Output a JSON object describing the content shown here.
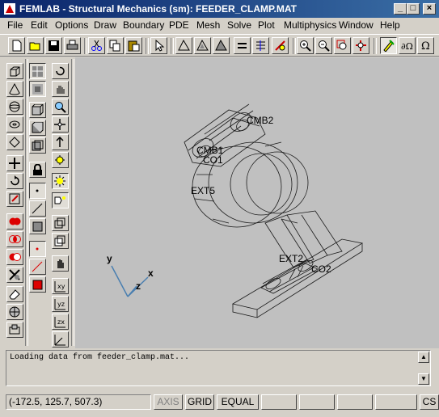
{
  "window": {
    "title": "FEMLAB - Structural Mechanics (sm): FEEDER_CLAMP.MAT"
  },
  "window_controls": {
    "minimize": "_",
    "maximize": "□",
    "close": "×"
  },
  "menu": [
    {
      "label": "File"
    },
    {
      "label": "Edit"
    },
    {
      "label": "Options"
    },
    {
      "label": "Draw"
    },
    {
      "label": "Boundary"
    },
    {
      "label": "PDE"
    },
    {
      "label": "Mesh"
    },
    {
      "label": "Solve"
    },
    {
      "label": "Plot"
    },
    {
      "label": "Multiphysics"
    },
    {
      "label": "Window"
    },
    {
      "label": "Help"
    }
  ],
  "toolbar": {
    "icons": [
      "new-file-icon",
      "open-folder-icon",
      "save-icon",
      "print-icon",
      "cut-icon",
      "copy-icon",
      "paste-icon",
      "pointer-icon",
      "draw-mode-icon",
      "boundary-mode-icon",
      "subdomain-mode-icon",
      "equals-icon",
      "mesh-icon",
      "solve-icon",
      "zoom-in-icon",
      "zoom-out-icon",
      "zoom-window-icon",
      "zoom-extents-icon",
      "edit-icon",
      "omega-alpha-icon",
      "omega-icon"
    ]
  },
  "sidebar": {
    "axes_buttons": [
      "xy",
      "yz",
      "zx"
    ]
  },
  "canvas": {
    "background": "#c0c0c0",
    "labels": [
      "CMB2",
      "CMB1",
      "CO1",
      "EXT5",
      "EXT2",
      "CO2"
    ],
    "axes": {
      "x": "x",
      "y": "y",
      "z": "z"
    }
  },
  "message": {
    "text": "Loading data from feeder_clamp.mat..."
  },
  "status": {
    "coords": "(-172.5, 125.7, 507.3)",
    "axis": "AXIS",
    "grid": "GRID",
    "equal": "EQUAL",
    "cs": "CS"
  }
}
